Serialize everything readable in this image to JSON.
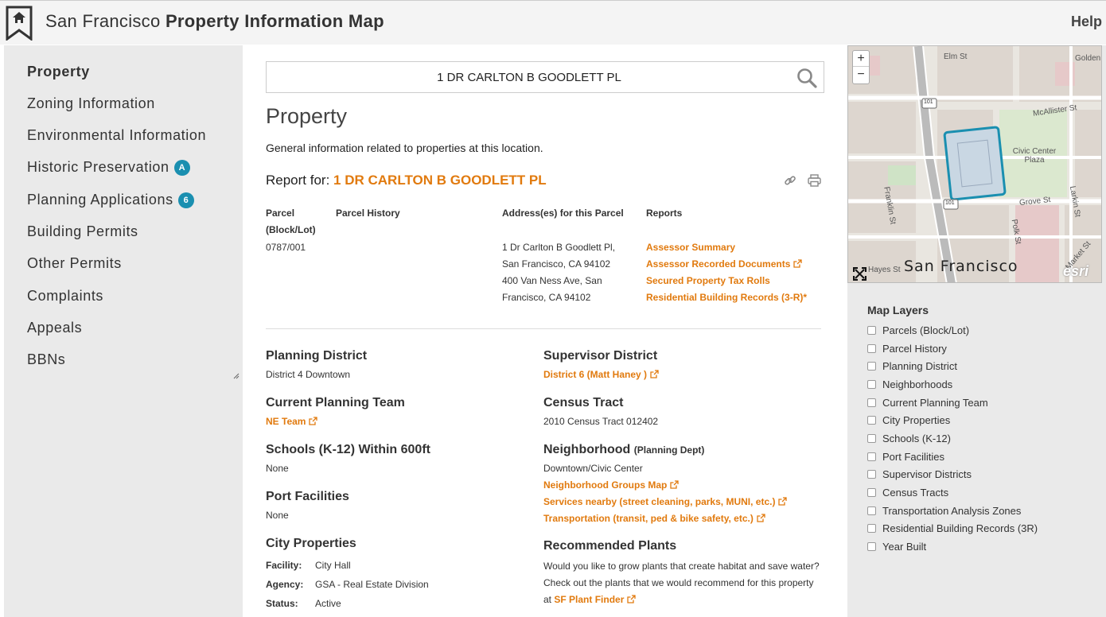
{
  "header": {
    "brand_light": "San Francisco",
    "brand_bold": "Property Information Map",
    "help": "Help"
  },
  "sidebar": {
    "items": [
      {
        "label": "Property",
        "active": true
      },
      {
        "label": "Zoning Information"
      },
      {
        "label": "Environmental Information"
      },
      {
        "label": "Historic Preservation",
        "badge": "A"
      },
      {
        "label": "Planning Applications",
        "badge": "6"
      },
      {
        "label": "Building Permits"
      },
      {
        "label": "Other Permits"
      },
      {
        "label": "Complaints"
      },
      {
        "label": "Appeals"
      },
      {
        "label": "BBNs"
      }
    ]
  },
  "search": {
    "value": "1 DR CARLTON B GOODLETT PL"
  },
  "main": {
    "title": "Property",
    "description": "General information related to properties at this location.",
    "report_for_label": "Report for:",
    "report_for_address": "1 DR CARLTON B GOODLETT PL",
    "table": {
      "headers": [
        "Parcel (Block/Lot)",
        "Parcel History",
        "Address(es) for this Parcel",
        "Reports"
      ],
      "parcel": "0787/001",
      "addresses": [
        "1 Dr Carlton B Goodlett Pl, San Francisco, CA 94102",
        "400 Van Ness Ave, San Francisco, CA 94102"
      ],
      "reports": [
        {
          "label": "Assessor Summary",
          "external": false
        },
        {
          "label": "Assessor Recorded Documents",
          "external": true
        },
        {
          "label": "Secured Property Tax Rolls",
          "external": false
        },
        {
          "label": "Residential Building Records (3-R)*",
          "external": false
        }
      ]
    },
    "sections": {
      "planning_district": {
        "heading": "Planning District",
        "value": "District 4 Downtown"
      },
      "current_planning_team": {
        "heading": "Current Planning Team",
        "link": "NE Team"
      },
      "schools": {
        "heading": "Schools (K-12) Within 600ft",
        "value": "None"
      },
      "port_facilities": {
        "heading": "Port Facilities",
        "value": "None"
      },
      "city_properties": {
        "heading": "City Properties",
        "rows": [
          {
            "label": "Facility:",
            "value": "City Hall"
          },
          {
            "label": "Agency:",
            "value": "GSA - Real Estate Division"
          },
          {
            "label": "Status:",
            "value": "Active"
          }
        ]
      },
      "supervisor_district": {
        "heading": "Supervisor District",
        "link": "District 6 (Matt Haney )"
      },
      "census_tract": {
        "heading": "Census Tract",
        "value": "2010 Census Tract 012402"
      },
      "neighborhood": {
        "heading": "Neighborhood",
        "heading_small": "(Planning Dept)",
        "value": "Downtown/Civic Center",
        "links": [
          "Neighborhood Groups Map",
          "Services nearby (street cleaning, parks, MUNI, etc.)",
          "Transportation (transit, ped & bike safety, etc.)"
        ]
      },
      "recommended_plants": {
        "heading": "Recommended Plants",
        "text": "Would you like to grow plants that create habitat and save water? Check out the plants that we would recommend for this property at",
        "link": "SF Plant Finder"
      }
    }
  },
  "map": {
    "zoom_in": "+",
    "zoom_out": "−",
    "city_label": "San Francisco",
    "attribution": "esri",
    "streets": [
      "Elm St",
      "Golden",
      "McAllister St",
      "Civic Center Plaza",
      "Franklin St",
      "Grove St",
      "Larkin St",
      "Polk St",
      "Hayes St",
      "Market St",
      "101",
      "101"
    ]
  },
  "layers": {
    "title": "Map Layers",
    "items": [
      "Parcels (Block/Lot)",
      "Parcel History",
      "Planning District",
      "Neighborhoods",
      "Current Planning Team",
      "City Properties",
      "Schools (K-12)",
      "Port Facilities",
      "Supervisor Districts",
      "Census Tracts",
      "Transportation Analysis Zones",
      "Residential Building Records (3R)",
      "Year Built"
    ]
  },
  "colors": {
    "accent": "#e17a0e",
    "badge": "#1a8fb0",
    "parcel_outline": "#1a8fb0"
  }
}
